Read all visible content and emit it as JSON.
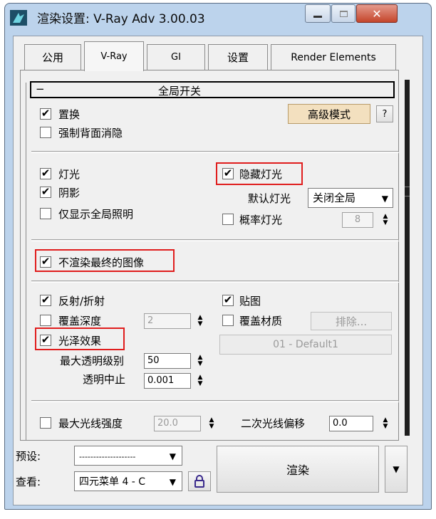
{
  "window": {
    "title": "渲染设置: V-Ray Adv 3.00.03"
  },
  "tabs": [
    {
      "label": "公用"
    },
    {
      "label": "V-Ray",
      "active": true
    },
    {
      "label": "GI"
    },
    {
      "label": "设置"
    },
    {
      "label": "Render Elements"
    }
  ],
  "rollout": {
    "collapse_symbol": "−",
    "title": "全局开关"
  },
  "section1": {
    "displacement": {
      "label": "置换",
      "checked": true
    },
    "force_backface": {
      "label": "强制背面消隐",
      "checked": false
    },
    "advanced_mode_button": "高级模式",
    "help_button": "?"
  },
  "section2": {
    "lights": {
      "label": "灯光",
      "checked": true
    },
    "hidden_lights": {
      "label": "隐藏灯光",
      "checked": true,
      "highlighted": true
    },
    "shadows": {
      "label": "阴影",
      "checked": true
    },
    "default_lights_label": "默认灯光",
    "default_lights_value": "关闭全局",
    "gi_only": {
      "label": "仅显示全局照明",
      "checked": false
    },
    "probabilistic_lights": {
      "label": "概率灯光",
      "checked": false
    },
    "prob_lights_value": "8"
  },
  "section3": {
    "dont_render_final": {
      "label": "不渲染最终的图像",
      "checked": true,
      "highlighted": true
    }
  },
  "section4": {
    "reflection_refraction": {
      "label": "反射/折射",
      "checked": true
    },
    "maps": {
      "label": "贴图",
      "checked": true
    },
    "override_depth": {
      "label": "覆盖深度",
      "checked": false
    },
    "override_depth_value": "2",
    "override_mtl": {
      "label": "覆盖材质",
      "checked": false
    },
    "exclude_button": "排除...",
    "glossy_effects": {
      "label": "光泽效果",
      "checked": true,
      "highlighted": true
    },
    "material_button": "01 - Default1",
    "max_transp_label": "最大透明级别",
    "max_transp_value": "50",
    "transp_cutoff_label": "透明中止",
    "transp_cutoff_value": "0.001"
  },
  "section5": {
    "max_ray_intensity": {
      "label": "最大光线强度",
      "checked": false
    },
    "max_ray_value": "20.0",
    "secondary_bias_label": "二次光线偏移",
    "secondary_bias_value": "0.0"
  },
  "footer": {
    "preset_label": "预设:",
    "preset_value": "--------------------",
    "view_label": "查看:",
    "view_value": "四元菜单 4 - C",
    "render_button": "渲染"
  },
  "colors": {
    "highlight": "#e01d1d",
    "window_frame": "#bcd3ec",
    "close_button": "#c4452b"
  }
}
